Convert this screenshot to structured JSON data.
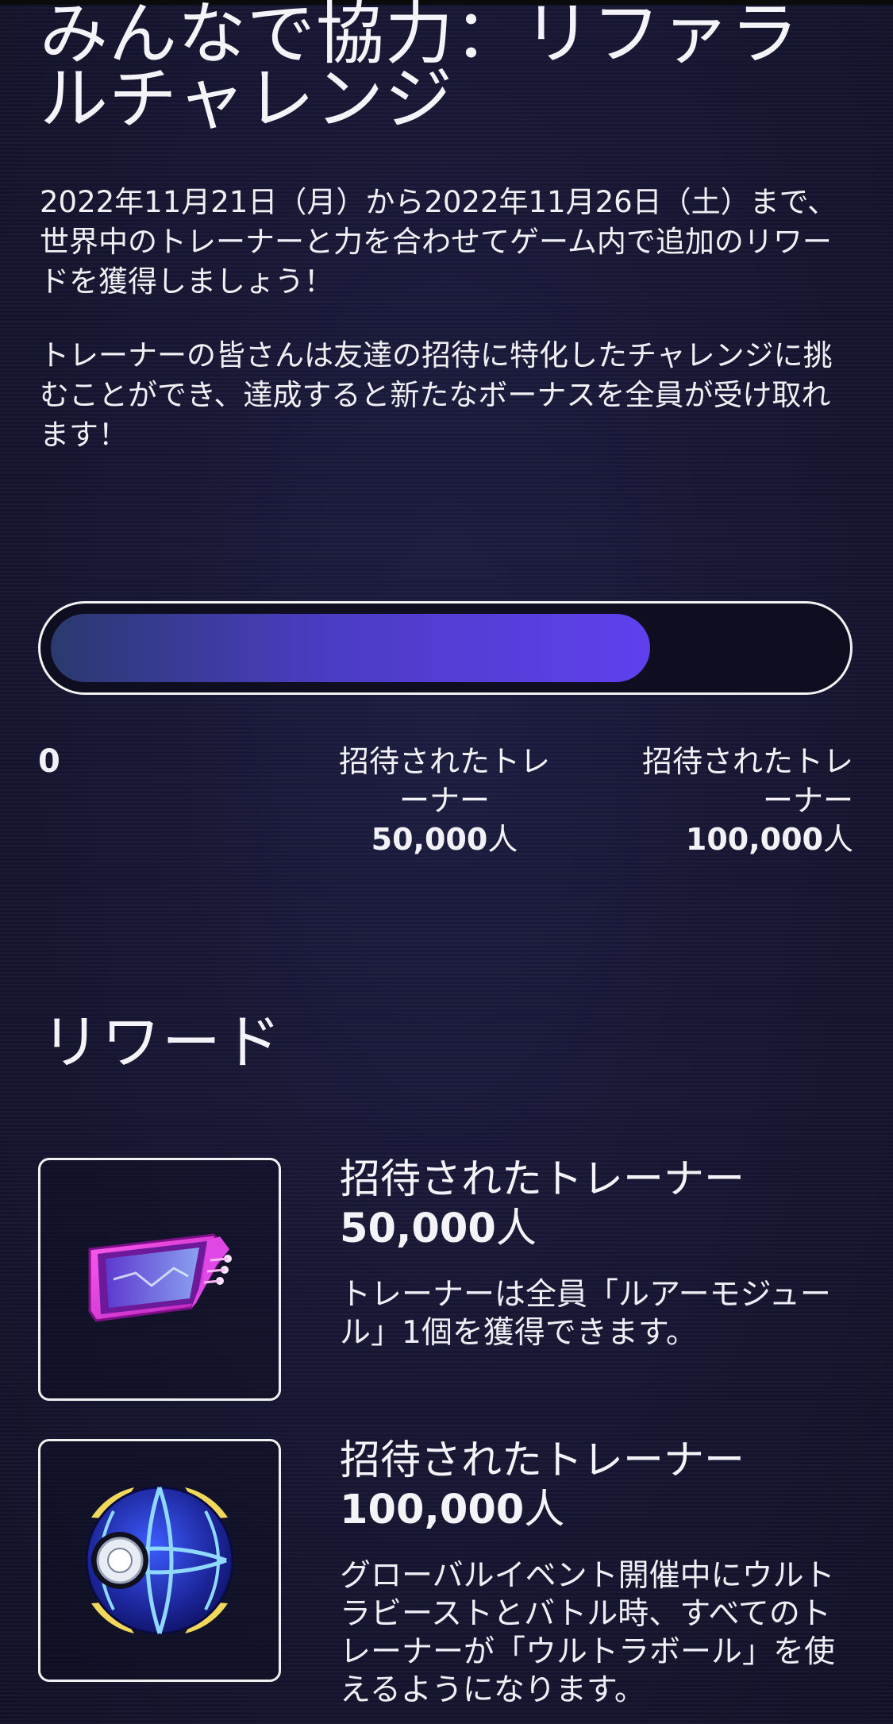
{
  "page": {
    "title": "みんなで協力：リファラルチャレンジ",
    "intro_paragraph_1": "2022年11月21日（月）から2022年11月26日（土）まで、世界中のトレーナーと力を合わせてゲーム内で追加のリワードを獲得しましょう！",
    "intro_paragraph_2": "トレーナーの皆さんは友達の招待に特化したチャレンジに挑むことができ、達成すると新たなボーナスを全員が受け取れます！"
  },
  "progress": {
    "fill_fraction": 0.76,
    "milestones": [
      {
        "value": "0"
      },
      {
        "label": "招待されたトレーナー",
        "number": "50,000",
        "unit": "人"
      },
      {
        "label": "招待されたトレーナー",
        "number": "100,000",
        "unit": "人"
      }
    ]
  },
  "rewards": {
    "section_title": "リワード",
    "items": [
      {
        "icon": "lure-module-icon",
        "label": "招待されたトレーナー",
        "number": "50,000",
        "unit": "人",
        "description": "トレーナーは全員「ルアーモジュール」1個を獲得できます。"
      },
      {
        "icon": "ultra-ball-icon",
        "label": "招待されたトレーナー",
        "number": "100,000",
        "unit": "人",
        "description": "グローバルイベント開催中にウルトラビーストとバトル時、すべてのトレーナーが「ウルトラボール」を使えるようになります。"
      }
    ]
  },
  "colors": {
    "background": "#161633",
    "progress_fill_start": "#2a3a6e",
    "progress_fill_end": "#6040ee",
    "text": "#f2f2f6"
  }
}
